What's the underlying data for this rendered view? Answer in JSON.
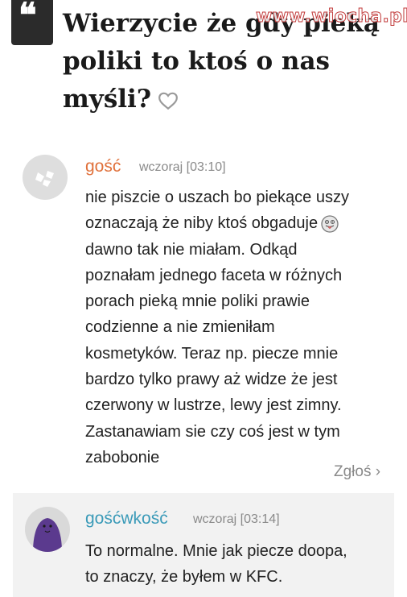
{
  "watermark": "www.wiocha.pl",
  "thread": {
    "title_line1": "Wierzycie że gdy pieką",
    "title_line2": "poliki to ktoś o nas",
    "title_line3": "myśli?"
  },
  "comments": [
    {
      "author": "gość",
      "time": "wczoraj [03:10]",
      "line1_pre": "nie piszcie o uszach bo piekące uszy",
      "line2_pre": "oznaczają że niby ktoś obgaduje",
      "line3": "dawno tak nie miałam. Odkąd",
      "line4": "poznałam jednego faceta w różnych",
      "line5": "porach pieką mnie poliki prawie",
      "line6": "codzienne a nie zmieniłam",
      "line7": "kosmetyków. Teraz np. piecze mnie",
      "line8": "bardzo tylko prawy aż widze że jest",
      "line9": "czerwony w lustrze, lewy jest zimny.",
      "line10": "Zastanawiam sie czy coś jest w tym",
      "line11": "zabobonie",
      "report": "Zgłoś ›"
    },
    {
      "author": "gośćwkość",
      "time": "wczoraj [03:14]",
      "line1": "To normalne. Mnie jak piecze doopa,",
      "line2": "to znaczy, że byłem w KFC."
    }
  ],
  "colors": {
    "author_guest": "#e0703a",
    "author_registered": "#3a9ab8",
    "badge": "#2b2b2b"
  }
}
